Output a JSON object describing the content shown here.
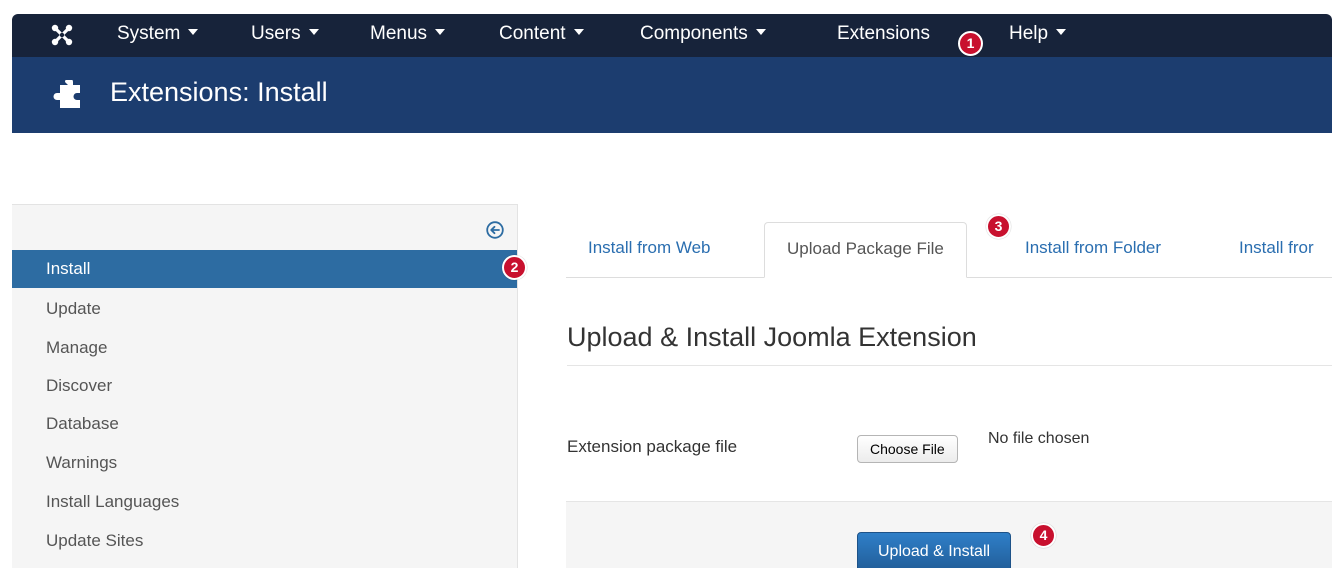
{
  "navbar": {
    "logo_icon": "joomla-logo-icon",
    "items": [
      {
        "label": "System",
        "has_caret": true
      },
      {
        "label": "Users",
        "has_caret": true
      },
      {
        "label": "Menus",
        "has_caret": true
      },
      {
        "label": "Content",
        "has_caret": true
      },
      {
        "label": "Components",
        "has_caret": true
      },
      {
        "label": "Extensions",
        "has_caret": false
      },
      {
        "label": "Help",
        "has_caret": true
      }
    ]
  },
  "header": {
    "icon": "puzzle-piece-icon",
    "title": "Extensions: Install"
  },
  "sidebar": {
    "toggle_icon": "circle-arrow-left-icon",
    "items": [
      {
        "label": "Install",
        "active": true
      },
      {
        "label": "Update",
        "active": false
      },
      {
        "label": "Manage",
        "active": false
      },
      {
        "label": "Discover",
        "active": false
      },
      {
        "label": "Database",
        "active": false
      },
      {
        "label": "Warnings",
        "active": false
      },
      {
        "label": "Install Languages",
        "active": false
      },
      {
        "label": "Update Sites",
        "active": false
      }
    ]
  },
  "main": {
    "tabs": [
      {
        "label": "Install from Web",
        "active": false
      },
      {
        "label": "Upload Package File",
        "active": true
      },
      {
        "label": "Install from Folder",
        "active": false
      },
      {
        "label": "Install fror",
        "active": false
      }
    ],
    "section_title": "Upload & Install Joomla Extension",
    "field_label": "Extension package file",
    "file_button_label": "Choose File",
    "file_status": "No file chosen",
    "submit_label": "Upload & Install"
  },
  "markers": [
    "1",
    "2",
    "3",
    "4"
  ],
  "colors": {
    "navbar_bg": "#17233a",
    "header_bg": "#1c3d6f",
    "active_item_bg": "#2d6ca2",
    "link": "#2a6eb0",
    "marker": "#c8102e",
    "button": "#2670b5"
  }
}
